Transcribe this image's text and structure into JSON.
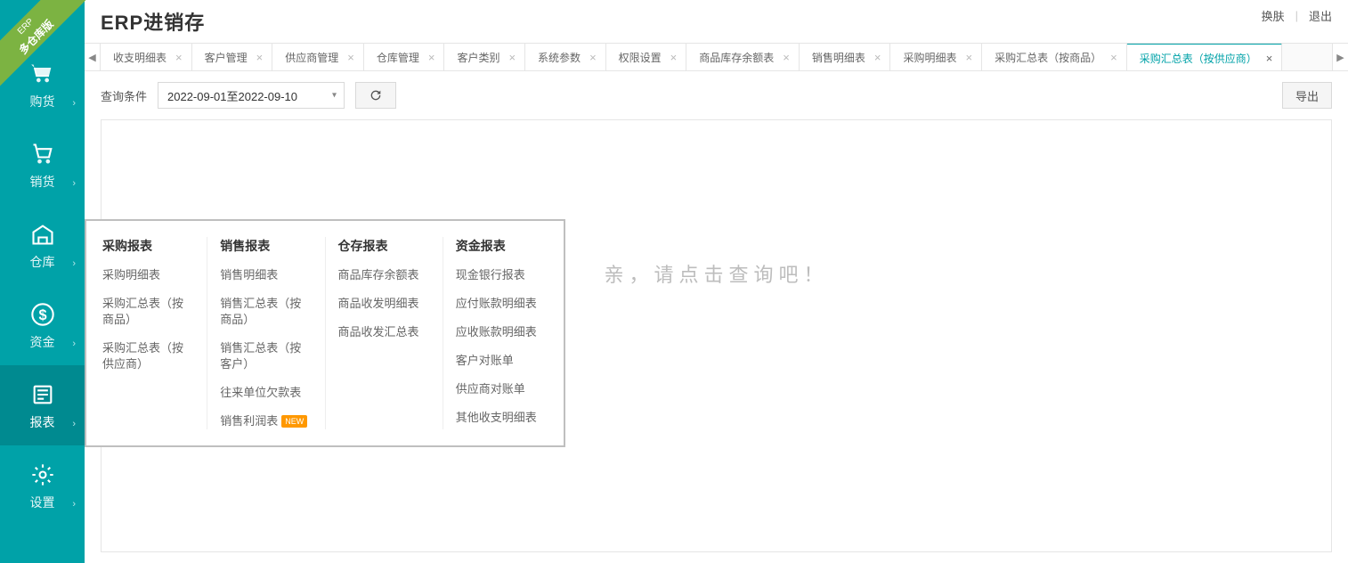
{
  "ribbon": {
    "line1": "ERP",
    "line2": "多仓库版"
  },
  "header": {
    "title": "ERP进销存",
    "actions": {
      "skin": "换肤",
      "logout": "退出"
    }
  },
  "sidebar": {
    "items": [
      {
        "label": "购货"
      },
      {
        "label": "销货"
      },
      {
        "label": "仓库"
      },
      {
        "label": "资金"
      },
      {
        "label": "报表"
      },
      {
        "label": "设置"
      }
    ]
  },
  "tabs": {
    "items": [
      {
        "label": "收支明细表"
      },
      {
        "label": "客户管理"
      },
      {
        "label": "供应商管理"
      },
      {
        "label": "仓库管理"
      },
      {
        "label": "客户类别"
      },
      {
        "label": "系统参数"
      },
      {
        "label": "权限设置"
      },
      {
        "label": "商品库存余额表"
      },
      {
        "label": "销售明细表"
      },
      {
        "label": "采购明细表"
      },
      {
        "label": "采购汇总表（按商品）"
      },
      {
        "label": "采购汇总表（按供应商）"
      }
    ]
  },
  "toolbar": {
    "query_label": "查询条件",
    "date_range": "2022-09-01至2022-09-10",
    "export_label": "导出"
  },
  "content": {
    "placeholder": "亲，请点击查询吧！"
  },
  "flyout": {
    "cols": [
      {
        "title": "采购报表",
        "items": [
          {
            "label": "采购明细表"
          },
          {
            "label": "采购汇总表（按商品）"
          },
          {
            "label": "采购汇总表（按供应商）"
          }
        ]
      },
      {
        "title": "销售报表",
        "items": [
          {
            "label": "销售明细表"
          },
          {
            "label": "销售汇总表（按商品）"
          },
          {
            "label": "销售汇总表（按客户）"
          },
          {
            "label": "往来单位欠款表"
          },
          {
            "label": "销售利润表",
            "new": true
          }
        ]
      },
      {
        "title": "仓存报表",
        "items": [
          {
            "label": "商品库存余额表"
          },
          {
            "label": "商品收发明细表"
          },
          {
            "label": "商品收发汇总表"
          }
        ]
      },
      {
        "title": "资金报表",
        "items": [
          {
            "label": "现金银行报表"
          },
          {
            "label": "应付账款明细表"
          },
          {
            "label": "应收账款明细表"
          },
          {
            "label": "客户对账单"
          },
          {
            "label": "供应商对账单"
          },
          {
            "label": "其他收支明细表"
          }
        ]
      }
    ],
    "new_badge": "NEW"
  }
}
